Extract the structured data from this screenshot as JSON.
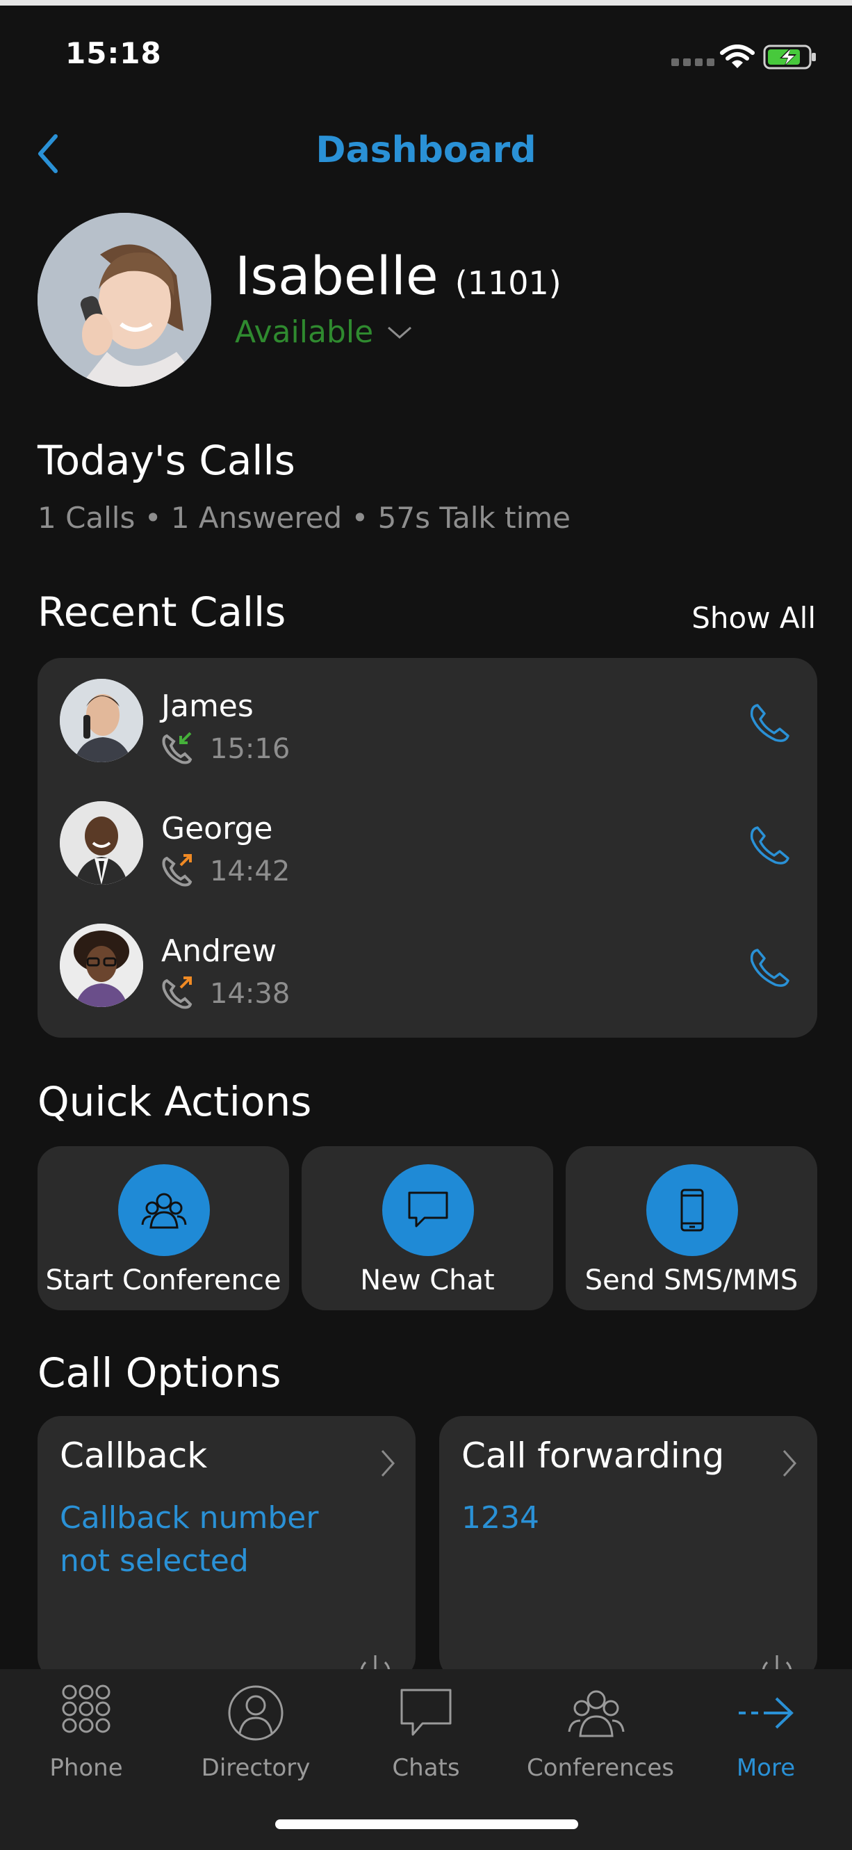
{
  "status_bar": {
    "time": "15:18"
  },
  "nav": {
    "title": "Dashboard",
    "back_icon": "chevron-left-icon"
  },
  "profile": {
    "name": "Isabelle",
    "extension": "(1101)",
    "status": "Available",
    "status_color": "#2f8a2f"
  },
  "todays_calls": {
    "heading": "Today's Calls",
    "summary": "1 Calls • 1 Answered • 57s Talk time"
  },
  "recent_calls": {
    "heading": "Recent Calls",
    "show_all": "Show All",
    "items": [
      {
        "name": "James",
        "time": "15:16",
        "direction": "incoming",
        "arrow_color": "#45b03a"
      },
      {
        "name": "George",
        "time": "14:42",
        "direction": "outgoing",
        "arrow_color": "#f08a24"
      },
      {
        "name": "Andrew",
        "time": "14:38",
        "direction": "outgoing",
        "arrow_color": "#f08a24"
      }
    ]
  },
  "quick_actions": {
    "heading": "Quick Actions",
    "items": [
      {
        "label": "Start Conference",
        "icon": "conference-icon"
      },
      {
        "label": "New Chat",
        "icon": "chat-bubble-icon"
      },
      {
        "label": "Send SMS/MMS",
        "icon": "mobile-phone-icon"
      }
    ]
  },
  "call_options": {
    "heading": "Call Options",
    "callback": {
      "title": "Callback",
      "line1": "Callback number",
      "line2": "not selected"
    },
    "forwarding": {
      "title": "Call forwarding",
      "value": "1234"
    }
  },
  "tabs": [
    {
      "label": "Phone",
      "icon": "keypad-icon",
      "active": false
    },
    {
      "label": "Directory",
      "icon": "person-icon",
      "active": false
    },
    {
      "label": "Chats",
      "icon": "chat-icon",
      "active": false
    },
    {
      "label": "Conferences",
      "icon": "conferences-icon",
      "active": false
    },
    {
      "label": "More",
      "icon": "arrow-right-icon",
      "active": true
    }
  ],
  "colors": {
    "accent": "#2a91d6",
    "background": "#121212",
    "card": "#2b2b2b"
  }
}
